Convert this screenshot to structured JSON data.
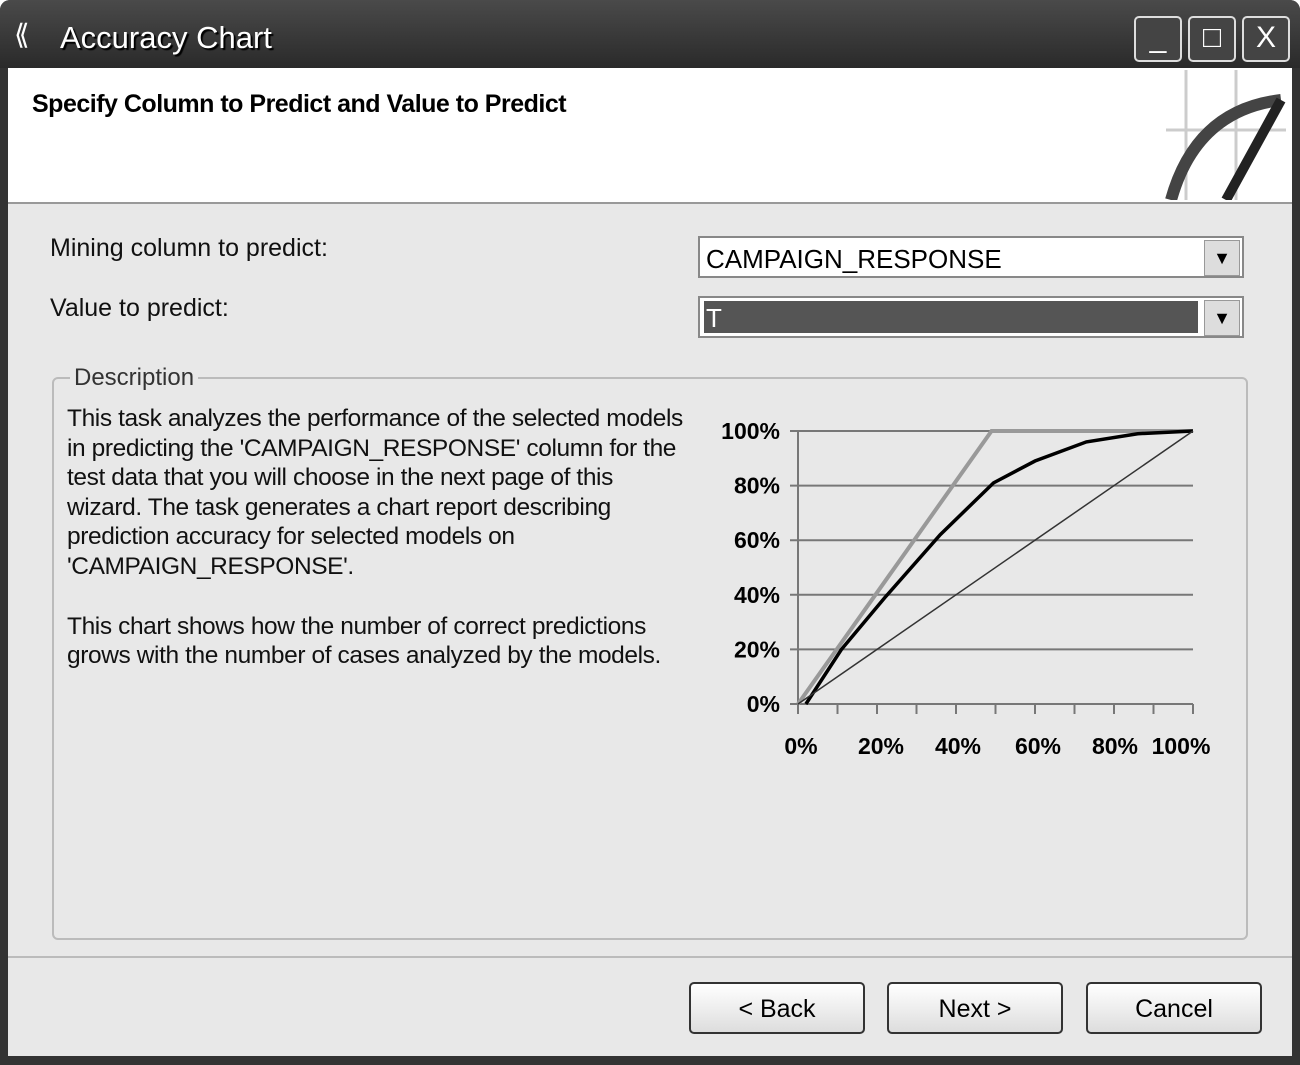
{
  "window": {
    "title": "Accuracy Chart",
    "minimize": "_",
    "maximize": "□",
    "close": "X"
  },
  "header": {
    "title": "Specify Column to Predict and Value to Predict"
  },
  "form": {
    "mining_column_label": "Mining column to predict:",
    "mining_column_value": "CAMPAIGN_RESPONSE",
    "value_label": "Value to predict:",
    "value_value": "T"
  },
  "description": {
    "legend": "Description",
    "para1": "This task analyzes the performance of the selected models in predicting the 'CAMPAIGN_RESPONSE' column for the test data that you will choose in the next page of this wizard. The task generates a chart report describing prediction accuracy for selected models on 'CAMPAIGN_RESPONSE'.",
    "para2": "This chart shows how the number of correct predictions grows with the number of cases analyzed by the models."
  },
  "buttons": {
    "back": "< Back",
    "next": "Next >",
    "cancel": "Cancel"
  },
  "chart_data": {
    "type": "line",
    "xlim": [
      0,
      100
    ],
    "ylim": [
      0,
      100
    ],
    "grid": "horizontal",
    "x_ticks": [
      "0%",
      "20%",
      "40%",
      "60%",
      "80%",
      "100%"
    ],
    "y_ticks": [
      "0%",
      "20%",
      "40%",
      "60%",
      "80%",
      "100%"
    ],
    "series": [
      {
        "color": "#999999",
        "x": [
          0,
          49,
          100
        ],
        "y": [
          0,
          100,
          100
        ]
      },
      {
        "color": "#000000",
        "x": [
          2,
          11,
          22,
          36,
          49.5,
          60,
          73,
          86,
          100
        ],
        "y": [
          0,
          20,
          39,
          62,
          81,
          89,
          96,
          99,
          100
        ]
      },
      {
        "color": "#333333",
        "x": [
          0,
          100
        ],
        "y": [
          0,
          100
        ]
      }
    ]
  }
}
